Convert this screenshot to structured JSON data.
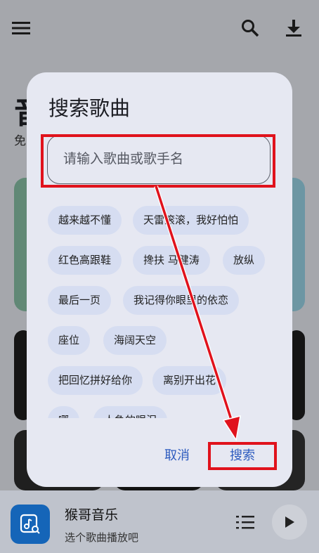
{
  "background": {
    "title_partial": "音",
    "subtitle_partial": "免"
  },
  "dialog": {
    "title": "搜索歌曲",
    "search_placeholder": "请输入歌曲或歌手名",
    "chips": [
      "越来越不懂",
      "天雷滚滚，我好怕怕",
      "红色高跟鞋",
      "搀扶 马健涛",
      "放纵",
      "最后一页",
      "我记得你眼里的依恋",
      "座位",
      "海阔天空",
      "把回忆拼好给你",
      "离别开出花",
      "哪",
      "人急的眼泪"
    ],
    "cancel_label": "取消",
    "search_label": "搜索"
  },
  "player": {
    "name": "猴哥音乐",
    "subtitle": "选个歌曲播放吧"
  },
  "colors": {
    "accent": "#2d5bbf",
    "highlight": "#e0121c",
    "chip_bg": "#d6ddf1"
  }
}
